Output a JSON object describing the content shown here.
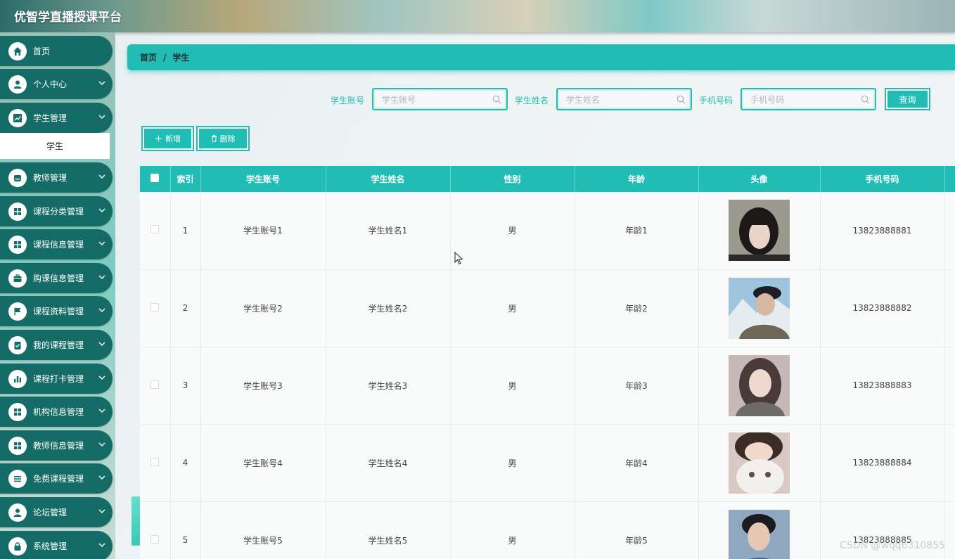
{
  "app": {
    "title": "优智学直播授课平台"
  },
  "sidebar": {
    "items": [
      {
        "label": "首页",
        "icon": "home-icon"
      },
      {
        "label": "个人中心",
        "icon": "user-icon"
      },
      {
        "label": "学生管理",
        "icon": "chart-icon"
      },
      {
        "label": "教师管理",
        "icon": "folder-icon"
      },
      {
        "label": "课程分类管理",
        "icon": "grid-icon"
      },
      {
        "label": "课程信息管理",
        "icon": "grid-icon"
      },
      {
        "label": "购课信息管理",
        "icon": "briefcase-icon"
      },
      {
        "label": "课程资料管理",
        "icon": "flag-icon"
      },
      {
        "label": "我的课程管理",
        "icon": "clipboard-icon"
      },
      {
        "label": "课程打卡管理",
        "icon": "bar-chart-icon"
      },
      {
        "label": "机构信息管理",
        "icon": "grid-icon"
      },
      {
        "label": "教师信息管理",
        "icon": "grid-icon"
      },
      {
        "label": "免费课程管理",
        "icon": "list-icon"
      },
      {
        "label": "论坛管理",
        "icon": "user-icon"
      },
      {
        "label": "系统管理",
        "icon": "lock-icon"
      }
    ],
    "submenu": {
      "label": "学生"
    }
  },
  "breadcrumb": {
    "home": "首页",
    "separator": "/",
    "current": "学生"
  },
  "search": {
    "account_label": "学生账号",
    "account_placeholder": "学生账号",
    "name_label": "学生姓名",
    "name_placeholder": "学生姓名",
    "phone_label": "手机号码",
    "phone_placeholder": "手机号码",
    "query_button": "查询"
  },
  "actions": {
    "add": "新增",
    "delete": "删除",
    "add_icon": "+"
  },
  "table": {
    "headers": [
      "索引",
      "学生账号",
      "学生姓名",
      "性别",
      "年龄",
      "头像",
      "手机号码"
    ],
    "rows": [
      {
        "index": "1",
        "account": "学生账号1",
        "name": "学生姓名1",
        "gender": "男",
        "age": "年龄1",
        "phone": "13823888881"
      },
      {
        "index": "2",
        "account": "学生账号2",
        "name": "学生姓名2",
        "gender": "男",
        "age": "年龄2",
        "phone": "13823888882"
      },
      {
        "index": "3",
        "account": "学生账号3",
        "name": "学生姓名3",
        "gender": "男",
        "age": "年龄3",
        "phone": "13823888883"
      },
      {
        "index": "4",
        "account": "学生账号4",
        "name": "学生姓名4",
        "gender": "男",
        "age": "年龄4",
        "phone": "13823888884"
      },
      {
        "index": "5",
        "account": "学生账号5",
        "name": "学生姓名5",
        "gender": "男",
        "age": "年龄5",
        "phone": "13823888885"
      }
    ]
  },
  "watermark": "CSDN @wqq6310855",
  "colors": {
    "accent": "#21bdb4",
    "sidebar_item": "#156c66"
  }
}
